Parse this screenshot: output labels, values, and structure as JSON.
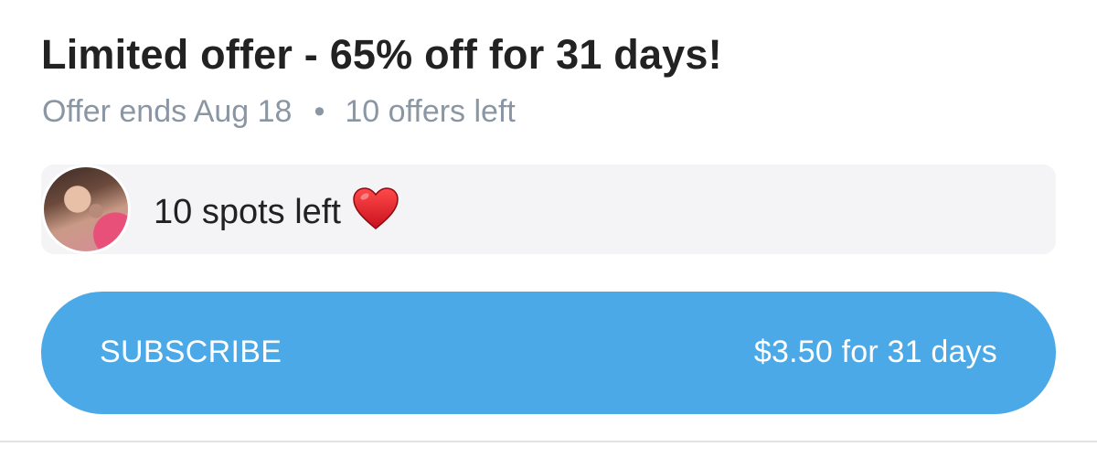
{
  "offer": {
    "title": "Limited offer - 65% off for 31 days!",
    "ends": "Offer ends Aug 18",
    "separator": "•",
    "offers_left": "10 offers left"
  },
  "spots": {
    "text": "10 spots left",
    "icon": "heart-icon",
    "heart_color": "#e8202e"
  },
  "subscribe": {
    "label": "SUBSCRIBE",
    "price": "$3.50 for 31 days",
    "color": "#4aa9e6"
  }
}
